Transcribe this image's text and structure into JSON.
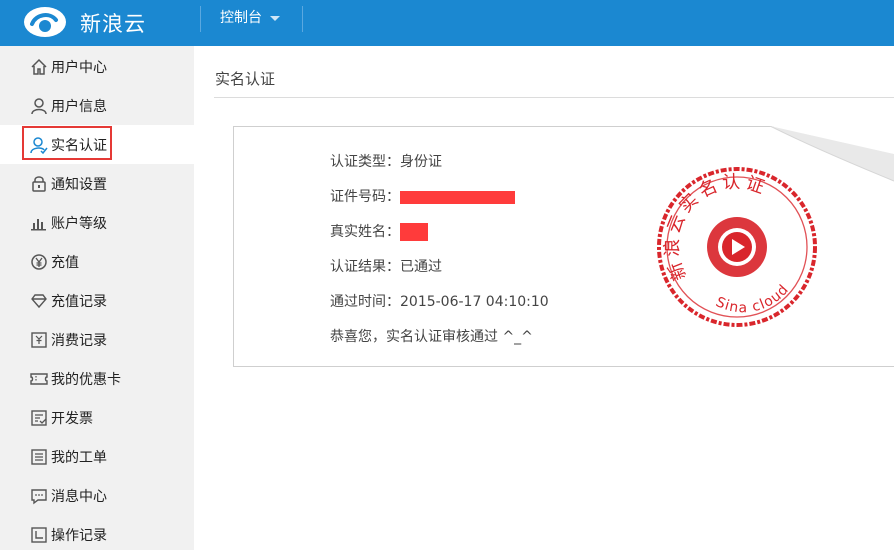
{
  "brand": {
    "name": "新浪云"
  },
  "topnav": {
    "console_label": "控制台"
  },
  "sidebar": {
    "items": [
      {
        "label": "用户中心",
        "icon": "home-icon"
      },
      {
        "label": "用户信息",
        "icon": "user-icon"
      },
      {
        "label": "实名认证",
        "icon": "user-check-icon",
        "active": true
      },
      {
        "label": "通知设置",
        "icon": "lock-icon"
      },
      {
        "label": "账户等级",
        "icon": "bar-chart-icon"
      },
      {
        "label": "充值",
        "icon": "yen-circle-icon"
      },
      {
        "label": "充值记录",
        "icon": "diamond-icon"
      },
      {
        "label": "消费记录",
        "icon": "receipt-icon"
      },
      {
        "label": "我的优惠卡",
        "icon": "ticket-icon"
      },
      {
        "label": "开发票",
        "icon": "invoice-icon"
      },
      {
        "label": "我的工单",
        "icon": "list-icon"
      },
      {
        "label": "消息中心",
        "icon": "message-icon"
      },
      {
        "label": "操作记录",
        "icon": "log-icon"
      }
    ]
  },
  "main": {
    "title": "实名认证",
    "card": {
      "type_label": "认证类型：",
      "type_value": "身份证",
      "id_label": "证件号码：",
      "name_label": "真实姓名：",
      "result_label": "认证结果：",
      "result_value": "已通过",
      "time_label": "通过时间：",
      "time_value": "2015-06-17 04:10:10",
      "congrats": "恭喜您，实名认证审核通过 ^_^"
    },
    "stamp": {
      "top_text": "新浪云实名认证",
      "bottom_text": "Sina cloud"
    }
  },
  "colors": {
    "topbar": "#1b88d1",
    "sidebar": "#f1f1f1",
    "stamp": "#d9262c",
    "highlight": "#e53935"
  }
}
